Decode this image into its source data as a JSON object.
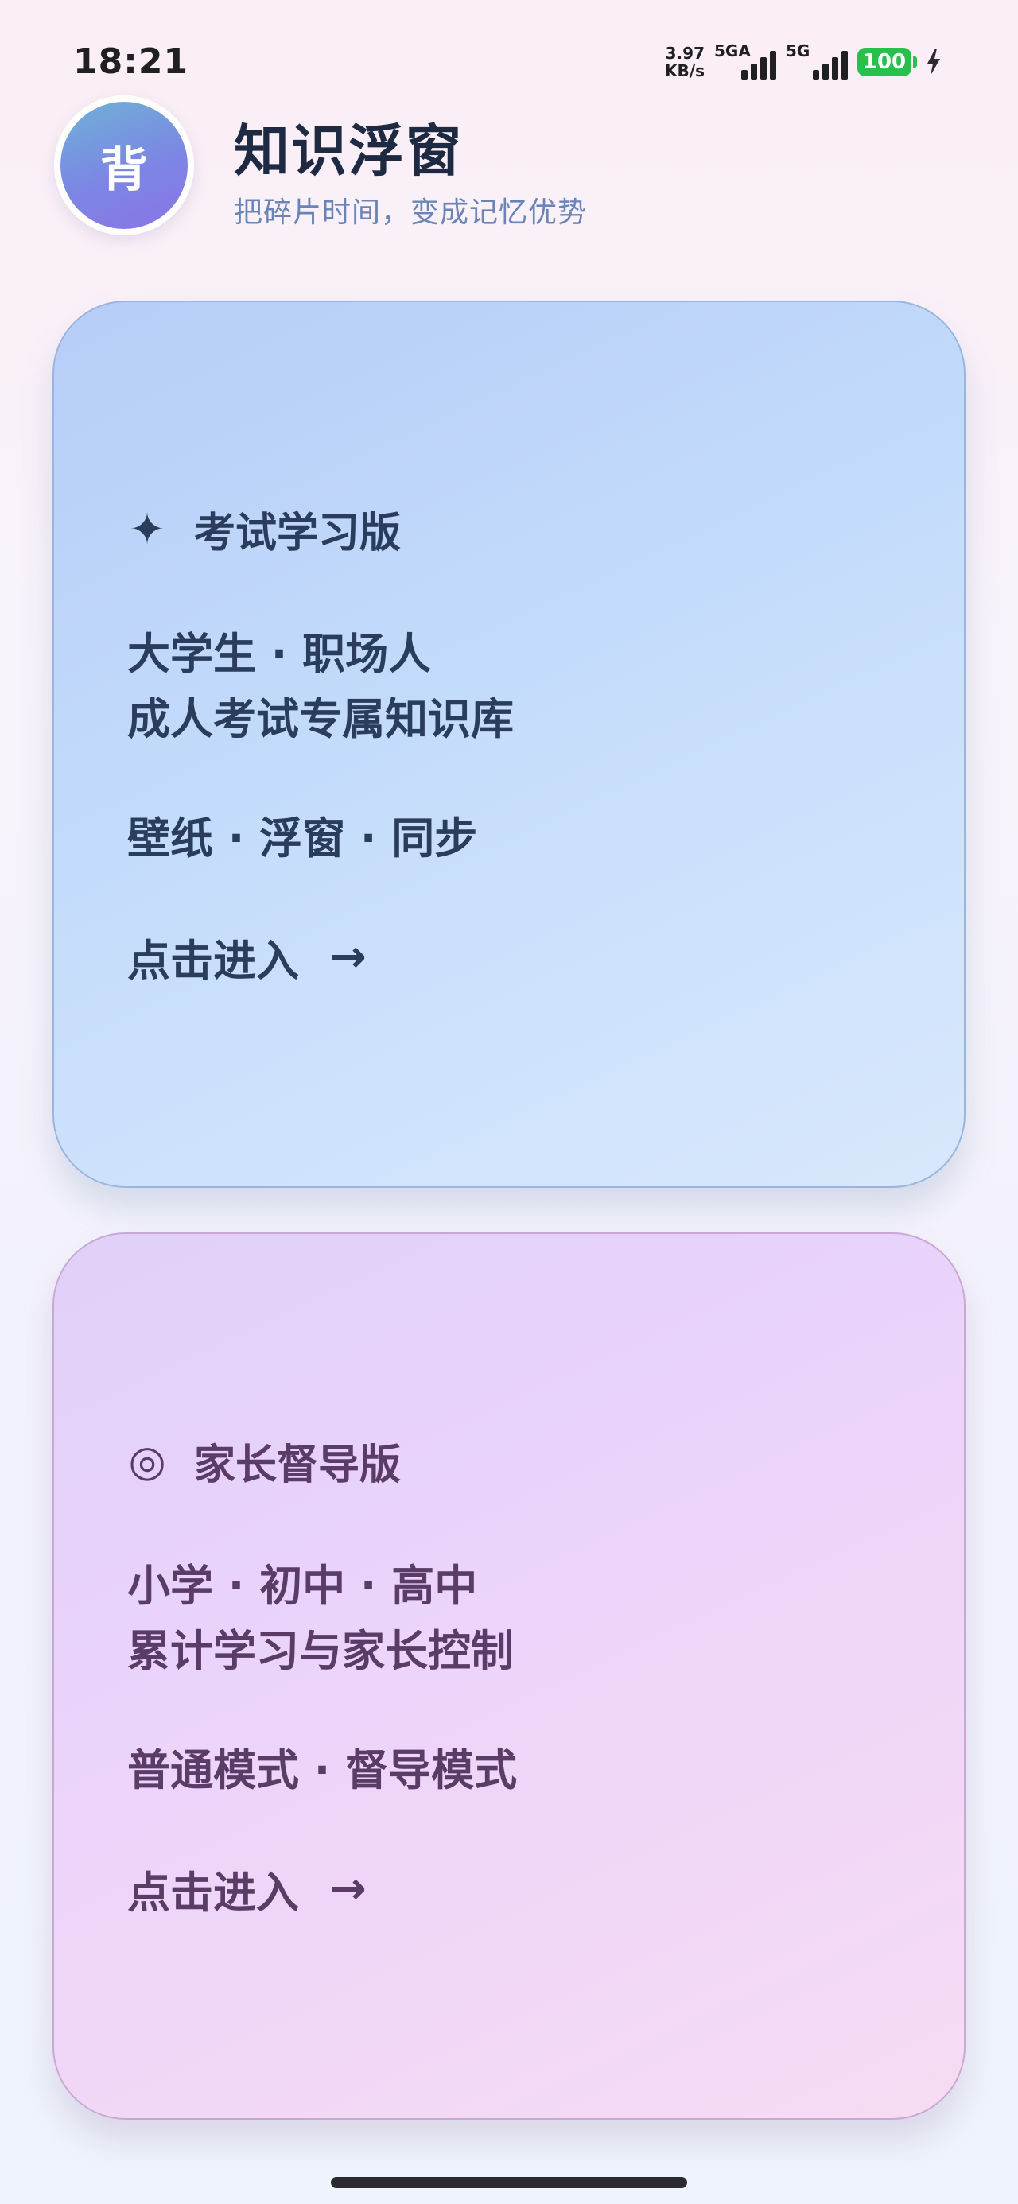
{
  "status_bar": {
    "time": "18:21",
    "net_speed_value": "3.97",
    "net_speed_unit": "KB/s",
    "signal_1_label": "5GA",
    "signal_2_label": "5G",
    "battery_level": "100",
    "battery_color": "#27c04a"
  },
  "header": {
    "avatar_char": "背",
    "title": "知识浮窗",
    "subtitle": "把碎片时间，变成记忆优势"
  },
  "cards": [
    {
      "icon": "✦",
      "icon_name": "sparkle-icon",
      "title": "考试学习版",
      "target_line_1": "大学生 · 职场人",
      "target_line_2": "成人考试专属知识库",
      "features": "壁纸 · 浮窗 · 同步",
      "enter_label": "点击进入",
      "arrow": "→",
      "accent_color": "#2b3d5c"
    },
    {
      "icon": "◎",
      "icon_name": "bullseye-icon",
      "title": "家长督导版",
      "target_line_1": "小学 · 初中 · 高中",
      "target_line_2": "累计学习与家长控制",
      "features": "普通模式 · 督导模式",
      "enter_label": "点击进入",
      "arrow": "→",
      "accent_color": "#5b3c66"
    }
  ]
}
